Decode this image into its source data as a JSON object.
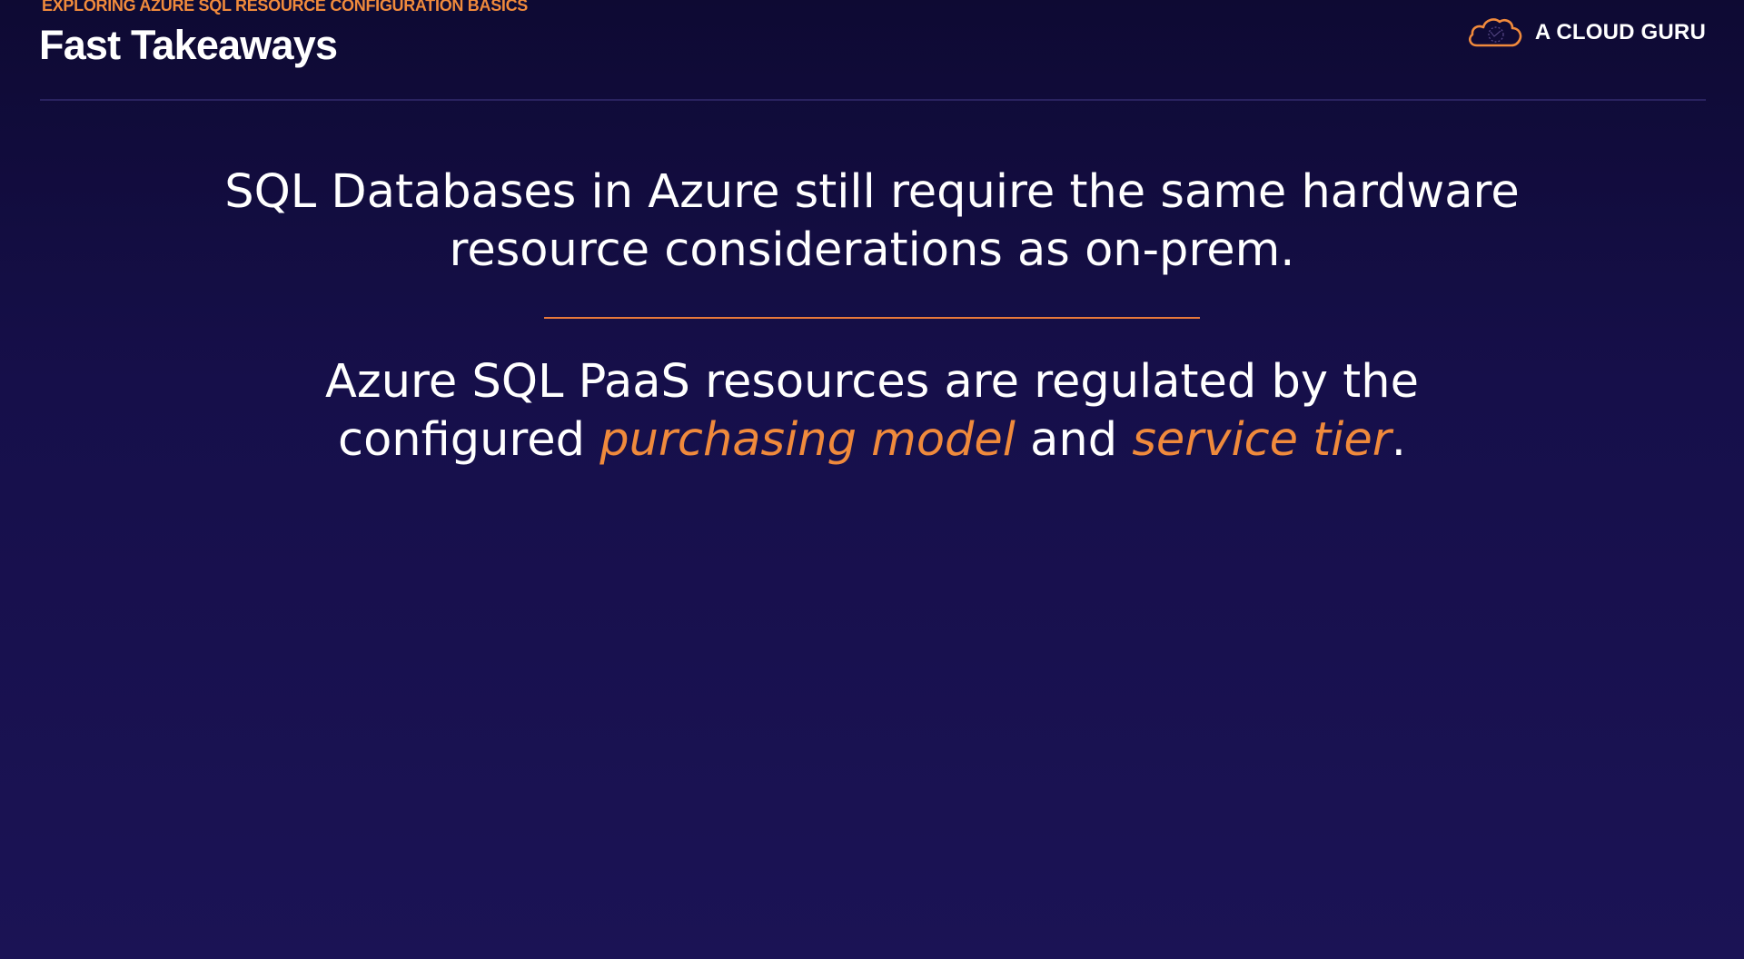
{
  "header": {
    "kicker": "EXPLORING AZURE SQL RESOURCE CONFIGURATION BASICS",
    "title": "Fast Takeaways"
  },
  "brand": {
    "name": "A CLOUD GURU",
    "logo_icon": "cloud-logo-icon",
    "accent_color": "#f08a3c"
  },
  "statement_1": {
    "line_1": "SQL Databases in Azure still require the same hardware",
    "line_2": "resource considerations as on-prem."
  },
  "statement_2": {
    "line_1": "Azure SQL PaaS resources are regulated by the",
    "line_2_prefix": "configured ",
    "emphasis_1": "purchasing model",
    "connector": " and ",
    "emphasis_2": "service tier",
    "line_2_suffix": "."
  },
  "colors": {
    "background_top": "#0e0a33",
    "background_bottom": "#1b1355",
    "accent": "#f08a3c",
    "text": "#ffffff"
  }
}
